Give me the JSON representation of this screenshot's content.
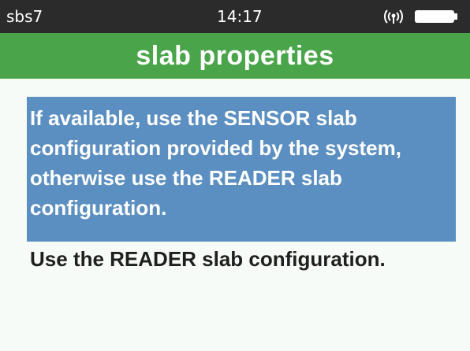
{
  "status_bar": {
    "device_name": "sbs7",
    "time": "14:17",
    "signal_icon": "wireless-signal-icon",
    "battery_icon": "battery-full-icon"
  },
  "title": "slab properties",
  "options": [
    {
      "label": "If available, use the SENSOR slab configuration provided by the system, otherwise use the READER slab configuration.",
      "selected": true
    },
    {
      "label": "Use the READER slab configuration.",
      "selected": false
    }
  ],
  "colors": {
    "status_bar_bg": "#2b2b2b",
    "title_bar_bg": "#4aa54a",
    "selected_bg": "#5b8fc1"
  }
}
